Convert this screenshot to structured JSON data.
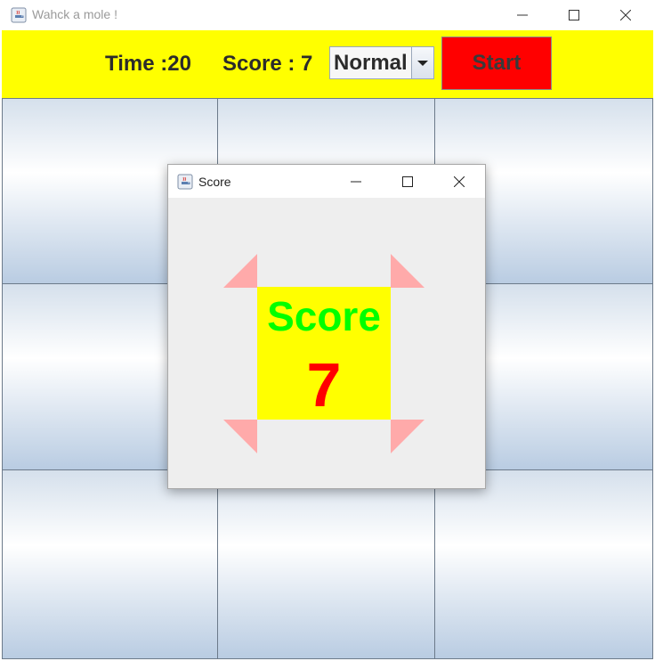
{
  "window": {
    "title": "Wahck a mole !",
    "icon": "java-icon",
    "controls": [
      "minimize-icon",
      "maximize-icon",
      "close-icon"
    ]
  },
  "toolbar": {
    "time_label": "Time  :20",
    "score_label": "Score : 7",
    "difficulty": {
      "selected": "Normal",
      "icon": "dropdown-arrow-icon"
    },
    "start_label": "Start",
    "colors": {
      "background": "#ffff00",
      "start_button": "#ff0000"
    }
  },
  "grid": {
    "rows": 3,
    "columns": 3
  },
  "score_dialog": {
    "title": "Score",
    "icon": "java-icon",
    "controls": [
      "minimize-icon",
      "maximize-icon",
      "close-icon"
    ],
    "heading": "Score",
    "value": "7",
    "decoration": "corner-arrow-icon",
    "colors": {
      "box": "#ffff00",
      "heading": "#00ff00",
      "value": "#ff0000",
      "arrows": "#ffaaaa"
    }
  }
}
